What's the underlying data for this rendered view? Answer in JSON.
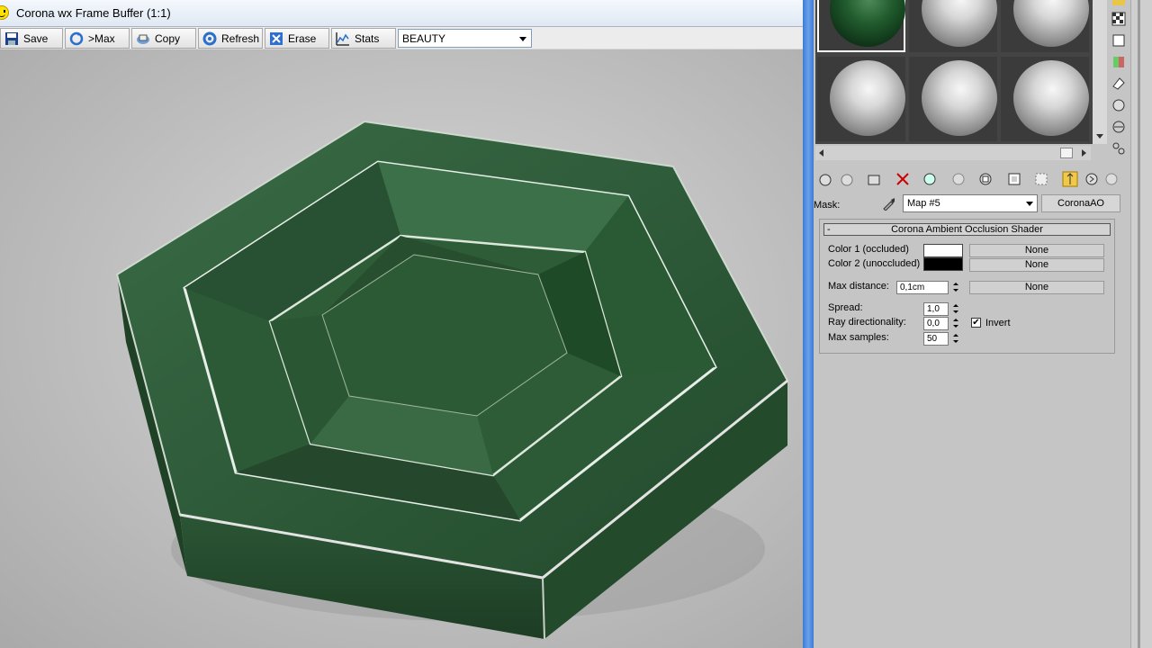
{
  "frame_buffer": {
    "title": "Corona wx Frame Buffer (1:1)",
    "toolbar": {
      "buttons": [
        {
          "label": "Save",
          "icon": "floppy-disk-icon"
        },
        {
          "label": ">Max",
          "icon": "send-to-max-icon"
        },
        {
          "label": "Copy",
          "icon": "copy-icon"
        },
        {
          "label": "Refresh",
          "icon": "refresh-icon"
        },
        {
          "label": "Erase",
          "icon": "erase-icon"
        },
        {
          "label": "Stats",
          "icon": "stats-chart-icon"
        }
      ],
      "channel_select": "BEAUTY"
    },
    "render_subject": "green-hexagonal-tray"
  },
  "material_editor": {
    "mask_label": "Mask:",
    "map_name": "Map #5",
    "map_type": "CoronaAO",
    "rollout": {
      "title": "Corona Ambient Occlusion Shader",
      "collapse_symbol": "-",
      "color1_label": "Color 1 (occluded)",
      "color1_value": "#ffffff",
      "color1_map": "None",
      "color2_label": "Color 2 (unoccluded)",
      "color2_value": "#000000",
      "color2_map": "None",
      "max_distance_label": "Max distance:",
      "max_distance_value": "0,1cm",
      "max_distance_map": "None",
      "spread_label": "Spread:",
      "spread_value": "1,0",
      "ray_dir_label": "Ray directionality:",
      "ray_dir_value": "0,0",
      "max_samples_label": "Max samples:",
      "max_samples_value": "50",
      "invert_label": "Invert",
      "invert_checked": "✔"
    }
  },
  "colors": {
    "title_bar": "#dfe8f3",
    "divider_blue": "#3c7ad6",
    "tray_green": "#2f5e3a",
    "floor_grey": "#c0c0c0"
  }
}
